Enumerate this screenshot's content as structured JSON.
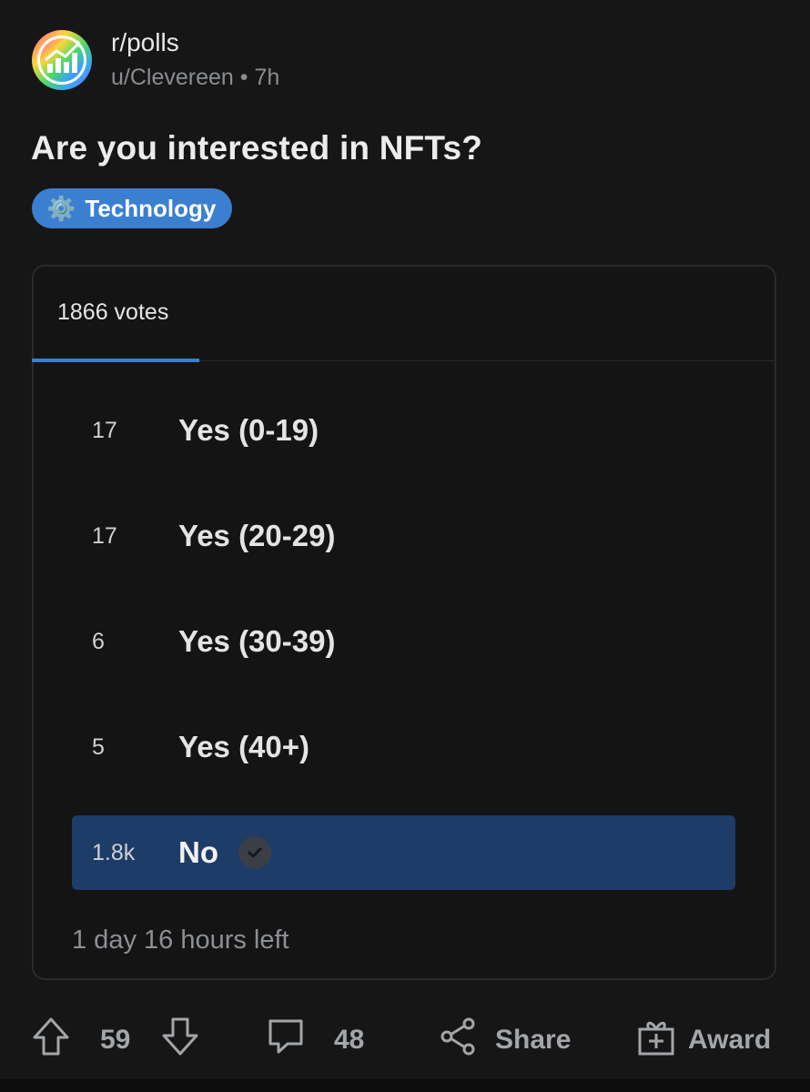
{
  "post": {
    "subreddit": "r/polls",
    "author": "u/Clevereen",
    "separator": "•",
    "age": "7h",
    "title": "Are you interested in NFTs?",
    "flair": {
      "icon": "⚙️",
      "label": "Technology",
      "color": "#3b7fd1"
    }
  },
  "poll": {
    "tab_label": "1866 votes",
    "options": [
      {
        "count": "17",
        "label": "Yes (0-19)",
        "selected": false
      },
      {
        "count": "17",
        "label": "Yes (20-29)",
        "selected": false
      },
      {
        "count": "6",
        "label": "Yes (30-39)",
        "selected": false
      },
      {
        "count": "5",
        "label": "Yes (40+)",
        "selected": false
      },
      {
        "count": "1.8k",
        "label": "No",
        "selected": true
      }
    ],
    "time_left": "1 day 16 hours left",
    "selected_color": "#1d3c68"
  },
  "actions": {
    "upvotes": "59",
    "comments": "48",
    "share_label": "Share",
    "award_label": "Award"
  }
}
